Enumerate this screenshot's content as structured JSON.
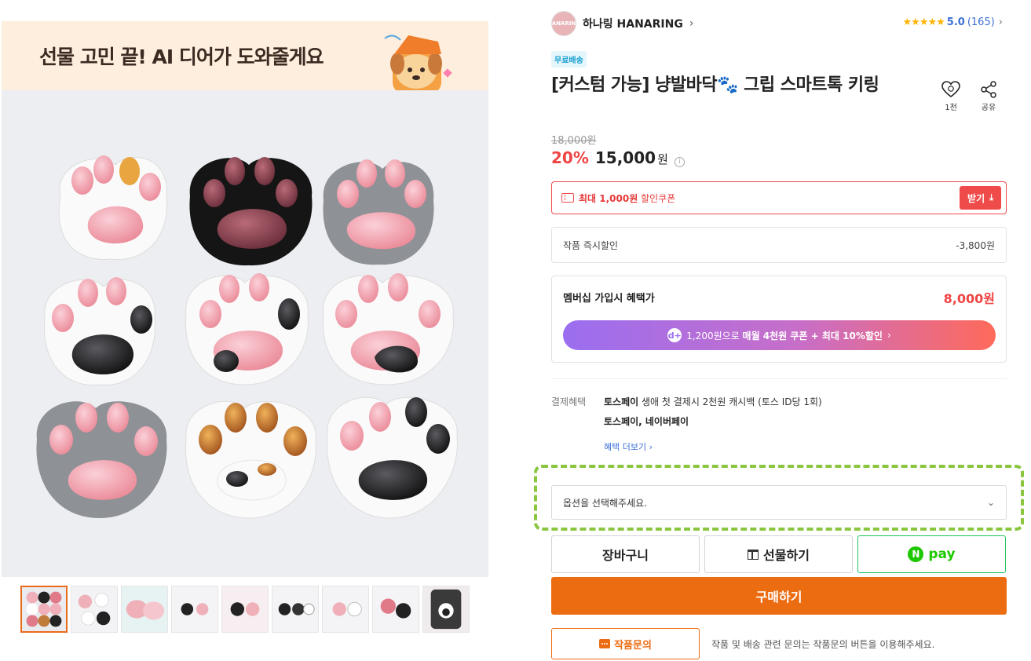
{
  "banner": {
    "text": "선물 고민 끝! AI 디어가 도와줄게요"
  },
  "seller": {
    "avatar_text": "HANARING",
    "name": "하나링 HANARING",
    "chevron": "›"
  },
  "rating": {
    "stars": "★★★★★",
    "score": "5.0",
    "count": "(165)",
    "chevron": "›"
  },
  "badge": {
    "free_shipping": "무료배송"
  },
  "product": {
    "title": "[커스텀 가능] 냥발바닥🐾 그립 스마트톡 키링",
    "wish_count": "1천",
    "share_label": "공유",
    "original_price": "18,000원",
    "discount": "20%",
    "price": "15,000",
    "won": "원",
    "info_icon": "i"
  },
  "coupon": {
    "text_prefix": "최대 1,000원",
    "text_suffix": " 할인쿠폰",
    "button_label": "받기",
    "button_icon": "⤓"
  },
  "instant_discount": {
    "label": "작품 즉시할인",
    "value": "-3,800원"
  },
  "membership": {
    "label": "멤버십 가입시 혜택가",
    "price": "8,000원",
    "logo": "d+",
    "cta_prefix": "1,200원으로 ",
    "cta_bold": "매월 4천원 쿠폰 + 최대 10%할인",
    "cta_chevron": "›"
  },
  "payment": {
    "label": "결제혜택",
    "line1_bold": "토스페이",
    "line1_rest": " 생애 첫 결제시 2천원 캐시백 (토스 ID당 1회)",
    "line2": "토스페이, 네이버페이",
    "more": "혜택 더보기 ›"
  },
  "option": {
    "placeholder": "옵션을 선택해주세요.",
    "chevron": "⌄"
  },
  "buttons": {
    "cart": "장바구니",
    "gift": "선물하기",
    "npay_letter": "N",
    "npay_text": "pay",
    "buy": "구매하기",
    "inquiry": "작품문의",
    "inquiry_note": "작품 및 배송 관련 문의는 작품문의 버튼을 이용해주세요."
  },
  "colors": {
    "accent": "#ec6c12",
    "red": "#ef4444",
    "npay": "#1ec800",
    "link": "#3b6fd8"
  }
}
